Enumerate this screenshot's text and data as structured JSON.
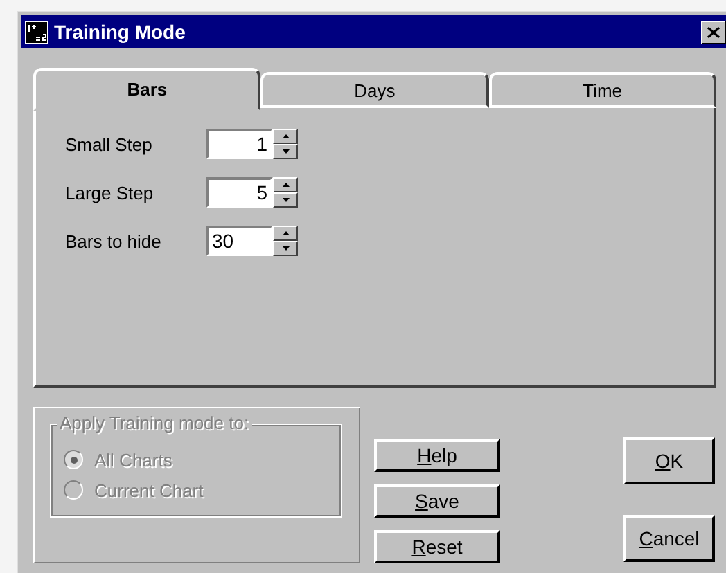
{
  "window": {
    "title": "Training Mode"
  },
  "tabs": [
    {
      "label": "Bars",
      "selected": true
    },
    {
      "label": "Days",
      "selected": false
    },
    {
      "label": "Time",
      "selected": false
    }
  ],
  "fields": [
    {
      "label": "Small Step",
      "value": "1",
      "right_aligned": true
    },
    {
      "label": "Large Step",
      "value": "5",
      "right_aligned": true
    },
    {
      "label": "Bars to hide",
      "value": "30",
      "right_aligned": false
    }
  ],
  "apply_group": {
    "title": "Apply Training mode to:",
    "disabled": true,
    "options": [
      {
        "label": "All Charts",
        "selected": true
      },
      {
        "label": "Current Chart",
        "selected": false
      }
    ]
  },
  "buttons": [
    {
      "label": "Help",
      "underline_first": true
    },
    {
      "label": "Save",
      "underline_first": true
    },
    {
      "label": "Reset",
      "underline_first": true
    }
  ],
  "dialog_buttons": [
    {
      "label": "OK",
      "underline_first": true
    },
    {
      "label": "Cancel",
      "underline_first": true
    }
  ]
}
